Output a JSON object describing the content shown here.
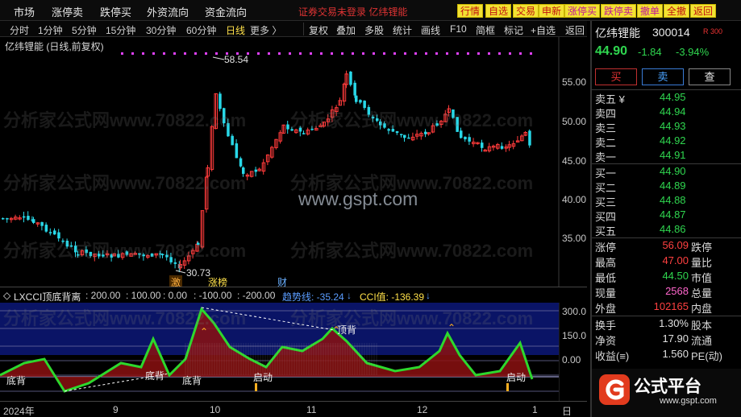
{
  "menu": [
    "市场",
    "涨停卖",
    "跌停买",
    "外资流向",
    "资金流向"
  ],
  "notice": "证券交易未登录  亿纬锂能",
  "quick_buttons": [
    "行情",
    "自选",
    "交易",
    "申新",
    "涨停买",
    "跌停卖",
    "撤单",
    "全撤",
    "返回"
  ],
  "periods": [
    "分时",
    "1分钟",
    "5分钟",
    "15分钟",
    "30分钟",
    "60分钟",
    "日线",
    "更多 〉"
  ],
  "active_period": "日线",
  "tools": [
    "复权",
    "叠加",
    "多股",
    "统计",
    "画线",
    "F10",
    "简框",
    "标记",
    "+自选",
    "返回"
  ],
  "chart": {
    "caption": "亿纬锂能 (日线,前复权)",
    "price_ticks": [
      "55.00",
      "50.00",
      "45.00",
      "40.00",
      "35.00"
    ],
    "high_label": "58.54",
    "low_label": "30.73",
    "tags": [
      "激",
      "涨榜",
      "财"
    ],
    "watermark_url": "www.gspt.com",
    "watermark_text": "分析家公式网www.70822.com"
  },
  "indicator": {
    "name": "LXCCI顶底背离",
    "p1": ": 200.00",
    "p2": ": 100.00",
    "p3": ": 0.00",
    "p4": ": -100.00",
    "p5": ": -200.00",
    "trend_label": "趋势线: -35.24",
    "cci_label": "CCI值: -136.39",
    "ticks": [
      "300.0",
      "150.0",
      "0.00"
    ],
    "annotations": [
      "顶背",
      "底背",
      "底背",
      "启动",
      "启动",
      "底背"
    ]
  },
  "dates": [
    "2024年",
    "9",
    "10",
    "11",
    "12",
    "1",
    "日"
  ],
  "stock": {
    "name": "亿纬锂能",
    "code": "300014",
    "badge": "R 300",
    "price": "44.90",
    "change": "-1.84",
    "pct": "-3.94%"
  },
  "trade_buttons": [
    "买",
    "卖",
    "查"
  ],
  "sell_orders": [
    {
      "label": "卖五 ¥",
      "price": "44.95"
    },
    {
      "label": "卖四",
      "price": "44.94"
    },
    {
      "label": "卖三",
      "price": "44.93"
    },
    {
      "label": "卖二",
      "price": "44.92"
    },
    {
      "label": "卖一",
      "price": "44.91"
    }
  ],
  "buy_orders": [
    {
      "label": "买一",
      "price": "44.90"
    },
    {
      "label": "买二",
      "price": "44.89"
    },
    {
      "label": "买三",
      "price": "44.88"
    },
    {
      "label": "买四",
      "price": "44.87"
    },
    {
      "label": "买五",
      "price": "44.86"
    }
  ],
  "stats": [
    {
      "label": "涨停",
      "value": "56.09",
      "right": "跌停",
      "color": "#ff4040"
    },
    {
      "label": "最高",
      "value": "47.00",
      "right": "量比",
      "color": "#ff4040"
    },
    {
      "label": "最低",
      "value": "44.50",
      "right": "市值",
      "color": "#2fd64f"
    },
    {
      "label": "现量",
      "value": "2568",
      "right": "总量",
      "color": "#ff66cc"
    },
    {
      "label": "外盘",
      "value": "102165",
      "right": "内盘",
      "color": "#ff4040"
    },
    {
      "label": "换手",
      "value": "1.30%",
      "right": "股本",
      "color": "#e0e0e0"
    },
    {
      "label": "净资",
      "value": "17.90",
      "right": "流通",
      "color": "#e0e0e0"
    },
    {
      "label": "收益(≡)",
      "value": "1.560",
      "right": "PE(动)",
      "color": "#e0e0e0"
    }
  ],
  "brand": {
    "title": "公式平台",
    "url": "www.gspt.com"
  },
  "colors": {
    "up": "#ff3b3b",
    "down": "#28d8e8",
    "accent": "#ffe14a"
  }
}
